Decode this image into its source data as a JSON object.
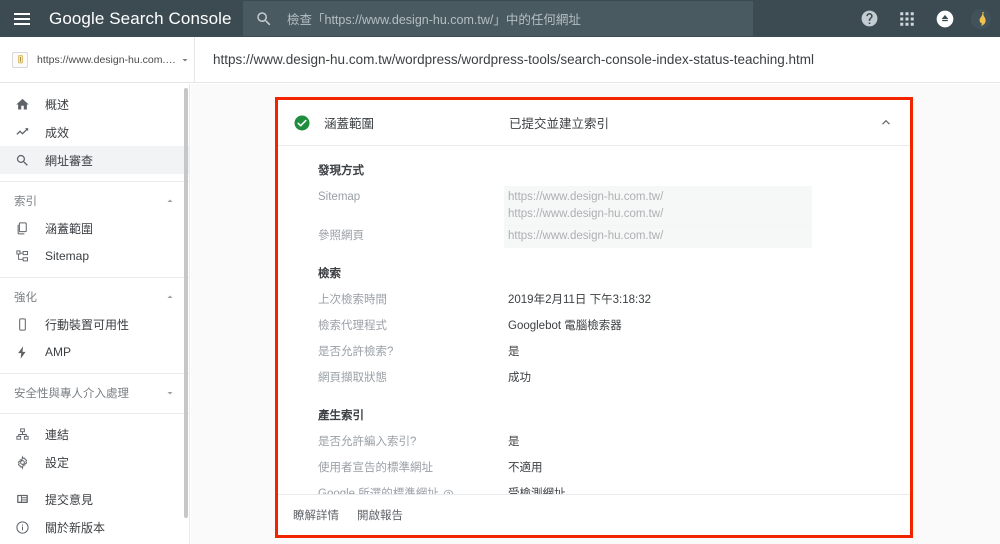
{
  "header": {
    "brand": "Google Search Console",
    "menu_icon": "hamburger-menu-icon",
    "search_icon": "search-icon",
    "search_placeholder": "檢查「https://www.design-hu.com.tw/」中的任何網址",
    "help_icon": "help-circle-icon",
    "apps_icon": "apps-grid-icon",
    "notifications_icon": "notifications-bell-icon",
    "avatar_label": "account-avatar",
    "bg_color": "#3c4b52",
    "search_bg_color": "#4a5a61"
  },
  "urlbar": {
    "property_name": "https://www.design-hu.com.t...",
    "property_caret_icon": "chevron-down-icon",
    "property_favicon": "site-favicon",
    "inspected_url": "https://www.design-hu.com.tw/wordpress/wordpress-tools/search-console-index-status-teaching.html"
  },
  "sidebar": {
    "items": [
      {
        "label": "概述",
        "icon": "home-icon",
        "active": false
      },
      {
        "label": "成效",
        "icon": "trending-up-icon",
        "active": false
      },
      {
        "label": "網址審查",
        "icon": "search-icon",
        "active": true
      }
    ],
    "groups": [
      {
        "label": "索引",
        "caret_icon": "chevron-up-icon",
        "expanded": true,
        "items": [
          {
            "label": "涵蓋範圍",
            "icon": "pages-copy-icon"
          },
          {
            "label": "Sitemap",
            "icon": "sitemap-icon"
          }
        ]
      },
      {
        "label": "強化",
        "caret_icon": "chevron-up-icon",
        "expanded": true,
        "items": [
          {
            "label": "行動裝置可用性",
            "icon": "mobile-device-icon"
          },
          {
            "label": "AMP",
            "icon": "lightning-bolt-icon"
          }
        ]
      },
      {
        "label": "安全性與專人介入處理",
        "caret_icon": "chevron-down-icon",
        "expanded": false,
        "items": []
      }
    ],
    "bottom_items": [
      {
        "label": "連結",
        "icon": "link-network-icon"
      },
      {
        "label": "設定",
        "icon": "gear-icon"
      }
    ],
    "footer_items": [
      {
        "label": "提交意見",
        "icon": "feedback-icon"
      },
      {
        "label": "關於新版本",
        "icon": "info-circle-icon"
      }
    ]
  },
  "card": {
    "status_icon": "green-check-circle-icon",
    "status_icon_color": "#1e8e3e",
    "title": "涵蓋範圍",
    "status": "已提交並建立索引",
    "collapse_icon": "chevron-up-icon",
    "highlight_border_color": "#f22400",
    "sections": [
      {
        "title": "發現方式",
        "rows": [
          {
            "label": "Sitemap",
            "values": [
              "https://www.design-hu.com.tw/",
              "https://www.design-hu.com.tw/"
            ],
            "redacted": true,
            "help": false
          },
          {
            "label": "參照網頁",
            "values": [
              "https://www.design-hu.com.tw/"
            ],
            "redacted": true,
            "help": false
          }
        ]
      },
      {
        "title": "檢索",
        "rows": [
          {
            "label": "上次檢索時間",
            "values": [
              "2019年2月11日 下午3:18:32"
            ],
            "redacted": false,
            "help": false
          },
          {
            "label": "檢索代理程式",
            "values": [
              "Googlebot 電腦檢索器"
            ],
            "redacted": false,
            "help": false
          },
          {
            "label": "是否允許檢索?",
            "values": [
              "是"
            ],
            "redacted": false,
            "help": false
          },
          {
            "label": "網頁擷取狀態",
            "values": [
              "成功"
            ],
            "redacted": false,
            "help": false
          }
        ]
      },
      {
        "title": "產生索引",
        "rows": [
          {
            "label": "是否允許編入索引?",
            "values": [
              "是"
            ],
            "redacted": false,
            "help": false
          },
          {
            "label": "使用者宣告的標準網址",
            "values": [
              "不適用"
            ],
            "redacted": false,
            "help": false
          },
          {
            "label": "Google 所選的標準網址",
            "values": [
              "受檢測網址"
            ],
            "redacted": false,
            "help": true
          }
        ]
      }
    ],
    "footer_links": [
      {
        "label": "瞭解詳情"
      },
      {
        "label": "開啟報告"
      }
    ]
  }
}
